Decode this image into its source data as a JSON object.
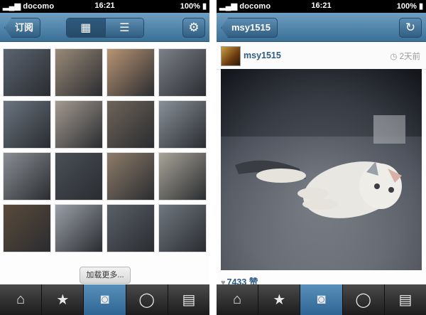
{
  "status": {
    "carrier": "docomo",
    "time": "16:21",
    "battery": "100%"
  },
  "left": {
    "back_label": "订阅",
    "load_more_label": "加载更多...",
    "tiles": [
      {
        "bg": "#5a6470"
      },
      {
        "bg": "#9a8a78"
      },
      {
        "bg": "#b89474"
      },
      {
        "bg": "#7c8088"
      },
      {
        "bg": "#6a7480"
      },
      {
        "bg": "#a49a90"
      },
      {
        "bg": "#6e6458"
      },
      {
        "bg": "#889098"
      },
      {
        "bg": "#8a8e94"
      },
      {
        "bg": "#4a5058"
      },
      {
        "bg": "#8e7c6a"
      },
      {
        "bg": "#a8a498"
      },
      {
        "bg": "#5a4a3a"
      },
      {
        "bg": "#9aa0a8"
      },
      {
        "bg": "#5a6068"
      },
      {
        "bg": "#707880"
      }
    ]
  },
  "right": {
    "back_label": "msy1515",
    "username": "msy1515",
    "time_ago": "2天前",
    "likes_count": "7433",
    "likes_word": "赞"
  },
  "tabs": [
    {
      "name": "home-icon",
      "glyph": "⌂"
    },
    {
      "name": "star-icon",
      "glyph": "★"
    },
    {
      "name": "camera-icon",
      "glyph": "◙"
    },
    {
      "name": "comment-icon",
      "glyph": "◯"
    },
    {
      "name": "news-icon",
      "glyph": "▤"
    }
  ]
}
